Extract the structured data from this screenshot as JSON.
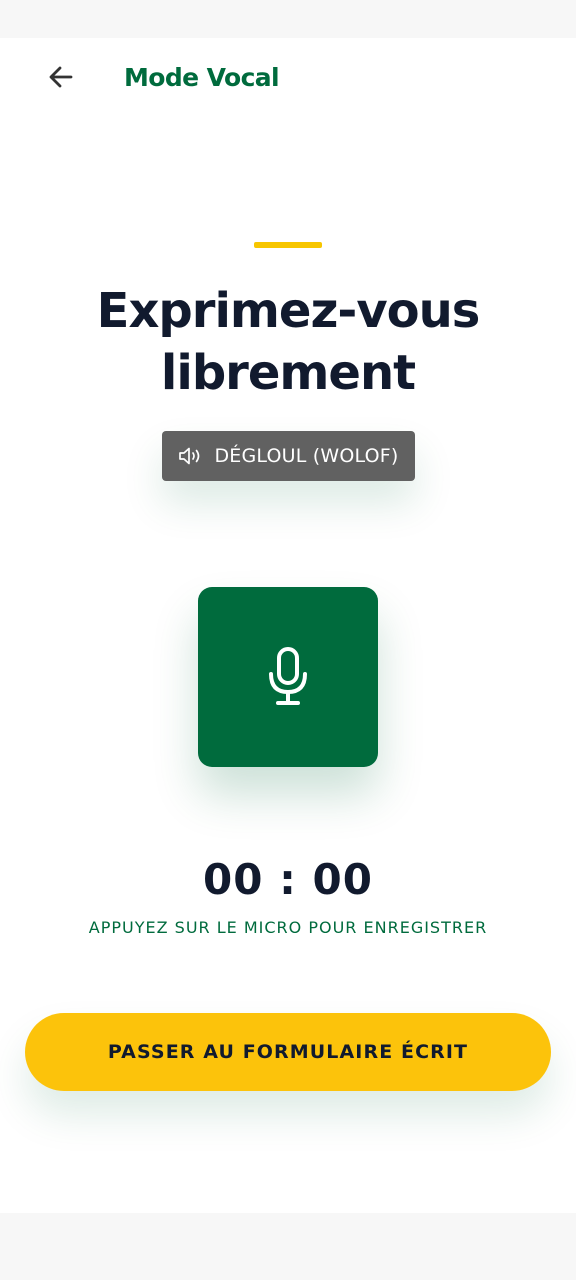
{
  "header": {
    "back_icon": "arrow-left-icon",
    "title": "Mode Vocal"
  },
  "main": {
    "headline_line1": "Exprimez-vous",
    "headline_line2": "librement",
    "language_chip": {
      "icon": "speaker-icon",
      "label": "DÉGLOUL (WOLOF)"
    },
    "mic_button": {
      "icon": "microphone-icon"
    },
    "timer": "00 : 00",
    "hint": "APPUYEZ SUR LE MICRO POUR ENREGISTRER",
    "switch_button_label": "PASSER AU FORMULAIRE ÉCRIT"
  },
  "colors": {
    "brand_green": "#006b3d",
    "accent_yellow": "#fcc30b",
    "text_dark": "#111a2e",
    "chip_gray": "#616161"
  }
}
